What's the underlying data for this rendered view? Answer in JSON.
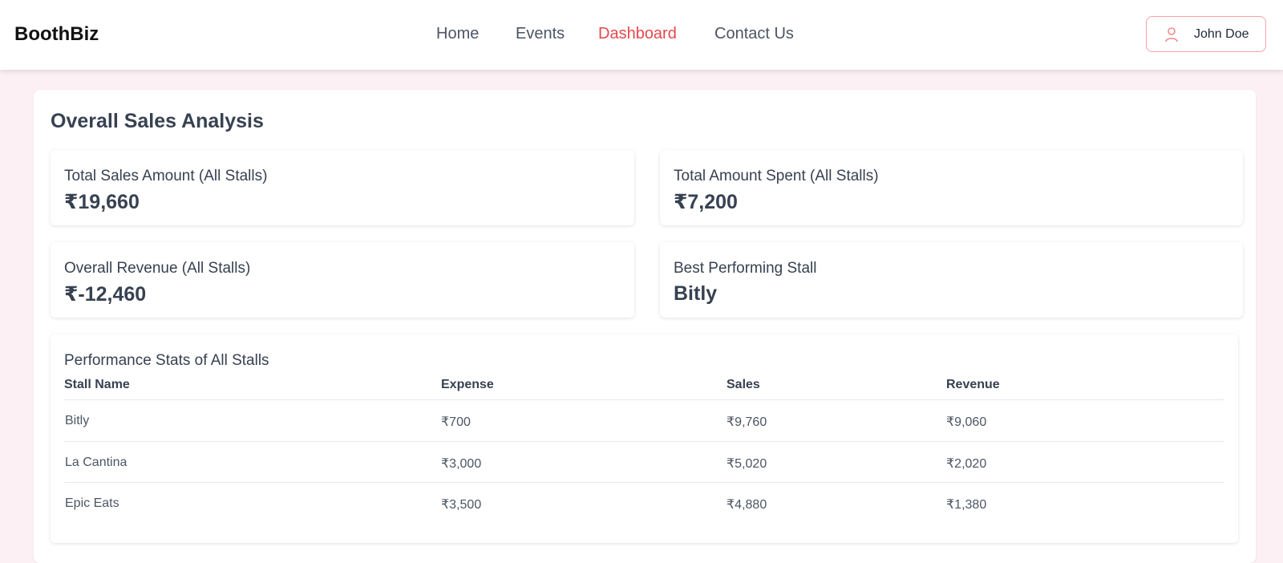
{
  "nav": {
    "brand": "BoothBiz",
    "links": [
      "Home",
      "Events",
      "Dashboard",
      "Contact Us"
    ],
    "active": "Dashboard",
    "user_name": "John Doe",
    "user_icon": "user-icon"
  },
  "colors": {
    "accent": "#e5484d",
    "page_background": "#fcf0f4",
    "text": "#374151"
  },
  "dashboard": {
    "title": "Overall Sales Analysis",
    "stats": [
      {
        "label": "Total Sales Amount (All Stalls)",
        "value": "₹19,660"
      },
      {
        "label": "Total Amount Spent (All Stalls)",
        "value": "₹7,200"
      },
      {
        "label": "Overall Revenue (All Stalls)",
        "value": "₹-12,460"
      },
      {
        "label": "Best Performing Stall",
        "value": "Bitly"
      }
    ],
    "table": {
      "title": "Performance Stats of All Stalls",
      "headers": [
        "Stall Name",
        "Expense",
        "Sales",
        "Revenue"
      ],
      "rows": [
        [
          "Bitly",
          "₹700",
          "₹9,760",
          "₹9,060"
        ],
        [
          "La Cantina",
          "₹3,000",
          "₹5,020",
          "₹2,020"
        ],
        [
          "Epic Eats",
          "₹3,500",
          "₹4,880",
          "₹1,380"
        ]
      ]
    }
  }
}
